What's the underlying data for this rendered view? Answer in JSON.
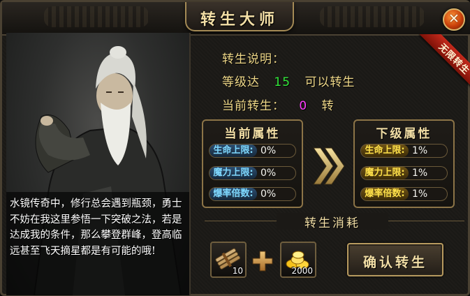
{
  "window": {
    "title": "转生大师",
    "close_glyph": "✕"
  },
  "ribbon": {
    "label": "无限转生"
  },
  "npc_story": "水镜传奇中，修行总会遇到瓶颈，勇士不妨在我这里参悟一下突破之法，若是达成我的条件，那么攀登群峰，登高临远甚至飞天摘星都是有可能的哦!",
  "rebirth_info": {
    "heading": "转生说明：",
    "level_prefix": "等级达",
    "level_required": "15",
    "level_suffix": "可以转生",
    "current_prefix": "当前转生：",
    "current_value": "0",
    "current_suffix": "转"
  },
  "current_attrs": {
    "heading": "当前属性",
    "rows": [
      {
        "label": "生命上限:",
        "value": "0%"
      },
      {
        "label": "魔力上限:",
        "value": "0%"
      },
      {
        "label": "爆率倍数:",
        "value": "0%"
      }
    ]
  },
  "next_attrs": {
    "heading": "下级属性",
    "rows": [
      {
        "label": "生命上限:",
        "value": "1%"
      },
      {
        "label": "魔力上限:",
        "value": "1%"
      },
      {
        "label": "爆率倍数:",
        "value": "1%"
      }
    ]
  },
  "cost": {
    "heading": "转生消耗",
    "items": [
      {
        "icon": "scroll-bundle-icon",
        "quantity": "10"
      },
      {
        "icon": "gold-coins-icon",
        "quantity": "2000"
      }
    ]
  },
  "confirm_button": {
    "label": "确认转生"
  },
  "colors": {
    "gold_text": "#f0d989",
    "level_green": "#32e83a",
    "rebirth_magenta": "#ff3cff",
    "current_label_blue": "#7fd9ff",
    "next_label_yellow": "#ffe14a",
    "ribbon_red": "#c42a1c"
  }
}
